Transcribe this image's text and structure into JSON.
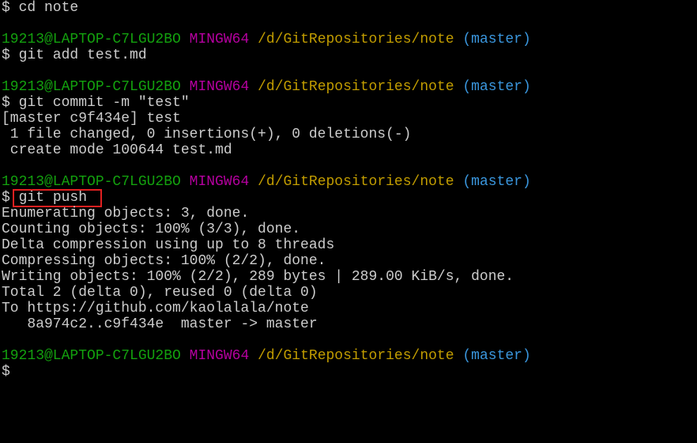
{
  "terminal": {
    "colors": {
      "background": "#000000",
      "text": "#cccccc",
      "user_host": "#13a10e",
      "shell": "#b4009e",
      "path": "#c19c00",
      "branch": "#3a96dd",
      "highlight": "#e02020"
    },
    "prompt": {
      "user_host": "19213@LAPTOP-C7LGU2BO",
      "shell": "MINGW64",
      "path": "/d/GitRepositories/note",
      "branch": "(master)",
      "symbol": "$"
    },
    "commands": {
      "cd": "$ cd note",
      "add": "$ git add test.md",
      "commit": "$ git commit -m \"test\"",
      "push_symbol": "$",
      "push": "git push",
      "final": "$"
    },
    "commit_output": [
      "[master c9f434e] test",
      " 1 file changed, 0 insertions(+), 0 deletions(-)",
      " create mode 100644 test.md"
    ],
    "push_output": [
      "Enumerating objects: 3, done.",
      "Counting objects: 100% (3/3), done.",
      "Delta compression using up to 8 threads",
      "Compressing objects: 100% (2/2), done.",
      "Writing objects: 100% (2/2), 289 bytes | 289.00 KiB/s, done.",
      "Total 2 (delta 0), reused 0 (delta 0)",
      "To https://github.com/kaolalala/note",
      "   8a974c2..c9f434e  master -> master"
    ]
  }
}
